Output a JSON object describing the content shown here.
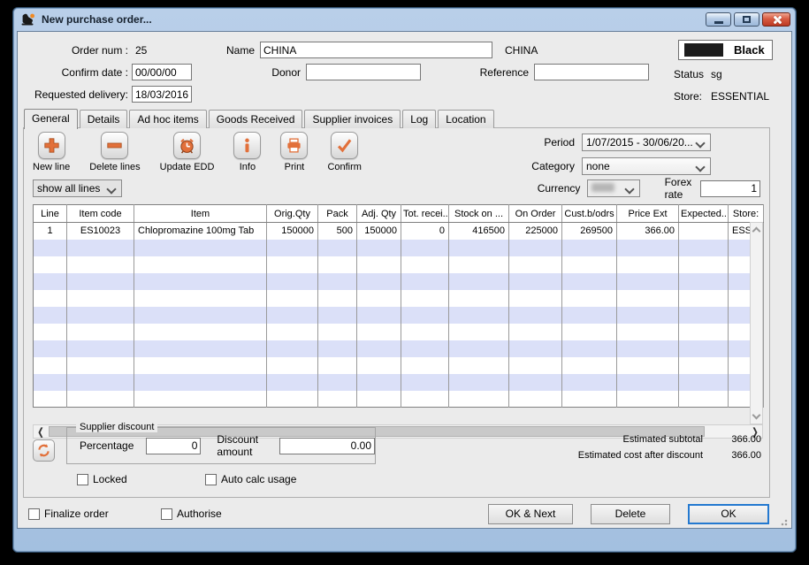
{
  "window": {
    "title": "New purchase order...",
    "controls": {
      "minimize": "minimize",
      "maximize": "maximize",
      "close": "close"
    }
  },
  "header": {
    "order_num_label": "Order num :",
    "order_num_value": "25",
    "name_label": "Name",
    "name_value": "CHINA",
    "name_static": "CHINA",
    "confirm_date_label": "Confirm date :",
    "confirm_date_value": "00/00/00",
    "donor_label": "Donor",
    "donor_value": "",
    "reference_label": "Reference",
    "reference_value": "",
    "requested_delivery_label": "Requested delivery:",
    "requested_delivery_value": "18/03/2016",
    "color_selector": {
      "name": "Black",
      "swatch": "#1c1c1c"
    },
    "status_label": "Status",
    "status_value": "sg",
    "store_label": "Store:",
    "store_value": "ESSENTIAL"
  },
  "tabs": [
    {
      "label": "General",
      "active": true
    },
    {
      "label": "Details",
      "active": false
    },
    {
      "label": "Ad hoc items",
      "active": false
    },
    {
      "label": "Goods Received",
      "active": false
    },
    {
      "label": "Supplier invoices",
      "active": false
    },
    {
      "label": "Log",
      "active": false
    },
    {
      "label": "Location",
      "active": false
    }
  ],
  "toolbar": {
    "buttons": [
      {
        "label": "New line",
        "icon": "plus-icon"
      },
      {
        "label": "Delete lines",
        "icon": "minus-icon"
      },
      {
        "label": "Update EDD",
        "icon": "alarm-clock-icon"
      },
      {
        "label": "Info",
        "icon": "info-icon"
      },
      {
        "label": "Print",
        "icon": "printer-icon"
      },
      {
        "label": "Confirm",
        "icon": "check-icon"
      }
    ],
    "period_label": "Period",
    "period_value": "1/07/2015 - 30/06/20...",
    "category_label": "Category",
    "category_value": "none"
  },
  "filters": {
    "show_lines_value": "show all lines",
    "currency_label": "Currency",
    "currency_redacted": true,
    "forex_label": "Forex rate",
    "forex_value": "1"
  },
  "table": {
    "columns": [
      "Line",
      "Item code",
      "Item",
      "Orig.Qty",
      "Pack",
      "Adj. Qty",
      "Tot. recei...",
      "Stock on ...",
      "On Order",
      "Cust.b/odrs",
      "Price Ext",
      "Expected...",
      "Store:"
    ],
    "rows": [
      [
        "1",
        "ES10023",
        "Chlopromazine 100mg Tab",
        "150000",
        "500",
        "150000",
        "0",
        "416500",
        "225000",
        "269500",
        "366.00",
        "",
        "ESS..."
      ]
    ],
    "empty_row_count": 10
  },
  "footer": {
    "supplier_discount_legend": "Supplier discount",
    "percentage_label": "Percentage",
    "percentage_value": "0",
    "discount_amount_label": "Discount amount",
    "discount_amount_value": "0.00",
    "locked_label": "Locked",
    "auto_calc_label": "Auto calc usage",
    "estimated_subtotal_label": "Estimated subtotal",
    "estimated_subtotal_value": "366.00",
    "estimated_cost_label": "Estimated cost after discount",
    "estimated_cost_value": "366.00",
    "finalize_label": "Finalize order",
    "authorise_label": "Authorise",
    "ok_next_label": "OK & Next",
    "delete_label": "Delete",
    "ok_label": "OK"
  },
  "colors": {
    "accent_orange": "#e2703a",
    "row_alt": "#dbe0f8",
    "titlebar_blue": "#aec7e5"
  }
}
